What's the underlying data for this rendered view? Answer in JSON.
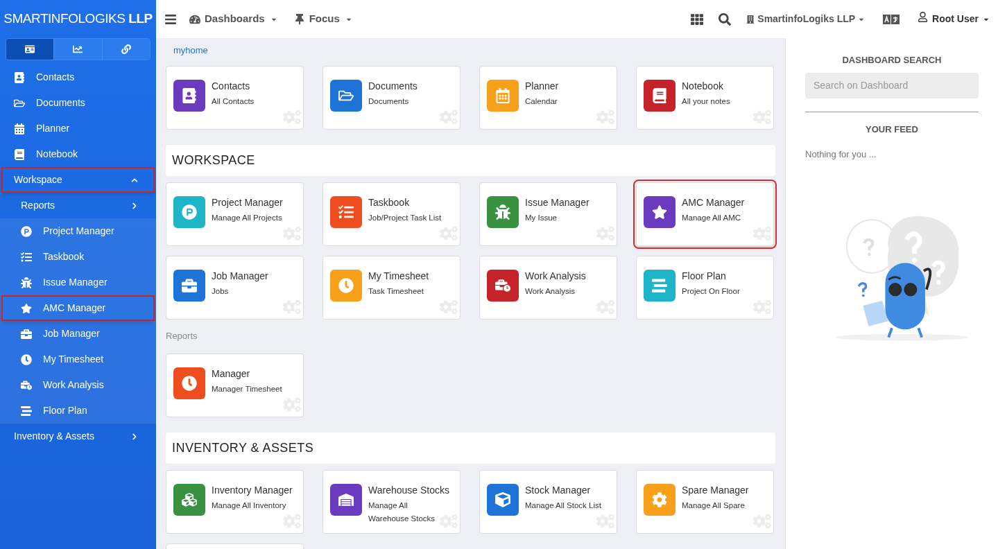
{
  "brand": {
    "name": "SMARTINFOLOGIKS",
    "suffix": "LLP"
  },
  "sidebar": {
    "tabs": [
      {
        "selected": true
      },
      {
        "selected": false
      },
      {
        "selected": false
      }
    ],
    "items": [
      {
        "label": "Contacts",
        "kind": "link",
        "highlighted": false
      },
      {
        "label": "Documents",
        "kind": "link",
        "highlighted": false
      },
      {
        "label": "Planner",
        "kind": "link",
        "highlighted": false
      },
      {
        "label": "Notebook",
        "kind": "link",
        "highlighted": false
      },
      {
        "label": "Workspace",
        "kind": "group",
        "expanded": true,
        "highlighted": true,
        "children": [
          {
            "label": "Reports",
            "kind": "group",
            "expanded": false,
            "highlighted": false
          },
          {
            "label": "Project Manager",
            "kind": "link",
            "highlighted": false
          },
          {
            "label": "Taskbook",
            "kind": "link",
            "highlighted": false
          },
          {
            "label": "Issue Manager",
            "kind": "link",
            "highlighted": false
          },
          {
            "label": "AMC Manager",
            "kind": "link",
            "highlighted": true
          },
          {
            "label": "Job Manager",
            "kind": "link",
            "highlighted": false
          },
          {
            "label": "My Timesheet",
            "kind": "link",
            "highlighted": false
          },
          {
            "label": "Work Analysis",
            "kind": "link",
            "highlighted": false
          },
          {
            "label": "Floor Plan",
            "kind": "link",
            "highlighted": false
          }
        ]
      },
      {
        "label": "Inventory & Assets",
        "kind": "group",
        "expanded": false,
        "highlighted": false
      }
    ]
  },
  "topbar": {
    "menus": [
      {
        "label": "Dashboards"
      },
      {
        "label": "Focus"
      }
    ],
    "company": "SmartinfoLogiks LLP",
    "user": "Root User"
  },
  "breadcrumb": "myhome",
  "sections": [
    {
      "kind": "plain",
      "cards": [
        {
          "kind": "app",
          "title": "Contacts",
          "subtitle": "All Contacts",
          "color": "#6a3bbf",
          "highlighted": false
        },
        {
          "kind": "app",
          "title": "Documents",
          "subtitle": "Documents",
          "color": "#1e74d6",
          "highlighted": false
        },
        {
          "kind": "app",
          "title": "Planner",
          "subtitle": "Calendar",
          "color": "#f9a01b",
          "highlighted": false
        },
        {
          "kind": "app",
          "title": "Notebook",
          "subtitle": "All your notes",
          "color": "#c6222a",
          "highlighted": false
        }
      ]
    },
    {
      "kind": "banner",
      "title": "WORKSPACE",
      "cards": [
        {
          "kind": "app",
          "title": "Project Manager",
          "subtitle": "Manage All Projects",
          "color": "#1fb5c9",
          "highlighted": false
        },
        {
          "kind": "app",
          "title": "Taskbook",
          "subtitle": "Job/Project Task List",
          "color": "#ee4d1f",
          "highlighted": false
        },
        {
          "kind": "app",
          "title": "Issue Manager",
          "subtitle": "My Issue",
          "color": "#3a9142",
          "highlighted": false
        },
        {
          "kind": "app",
          "title": "AMC Manager",
          "subtitle": "Manage All AMC",
          "color": "#6a3bbf",
          "highlighted": true
        },
        {
          "kind": "app",
          "title": "Job Manager",
          "subtitle": "Jobs",
          "color": "#1e74d6",
          "highlighted": false
        },
        {
          "kind": "app",
          "title": "My Timesheet",
          "subtitle": "Task Timesheet",
          "color": "#f9a01b",
          "highlighted": false
        },
        {
          "kind": "app",
          "title": "Work Analysis",
          "subtitle": "Work Analysis",
          "color": "#c6222a",
          "highlighted": false
        },
        {
          "kind": "app",
          "title": "Floor Plan",
          "subtitle": "Project On Floor",
          "color": "#1fb5c9",
          "highlighted": false
        }
      ]
    },
    {
      "kind": "label",
      "title": "Reports",
      "cards": [
        {
          "kind": "app",
          "title": "Manager",
          "subtitle": "Manager Timesheet",
          "color": "#ee4d1f",
          "highlighted": false
        }
      ]
    },
    {
      "kind": "banner",
      "title": "INVENTORY & ASSETS",
      "cards": [
        {
          "kind": "app",
          "title": "Inventory Manager",
          "subtitle": "Manage All Inventory",
          "color": "#3a9142",
          "highlighted": false
        },
        {
          "kind": "app",
          "title": "Warehouse Stocks",
          "subtitle": "Manage All Warehouse Stocks",
          "color": "#6a3bbf",
          "highlighted": false
        },
        {
          "kind": "app",
          "title": "Stock Manager",
          "subtitle": "Manage All Stock List",
          "color": "#1e74d6",
          "highlighted": false
        },
        {
          "kind": "app",
          "title": "Spare Manager",
          "subtitle": "Manage All Spare",
          "color": "#f9a01b",
          "highlighted": false
        },
        {
          "kind": "blank",
          "highlighted": false
        }
      ]
    }
  ],
  "right_panel": {
    "search_title": "DASHBOARD SEARCH",
    "search": {
      "placeholder": "Search on Dashboard"
    },
    "feed_title": "YOUR FEED",
    "feed_empty": "Nothing for you ..."
  }
}
